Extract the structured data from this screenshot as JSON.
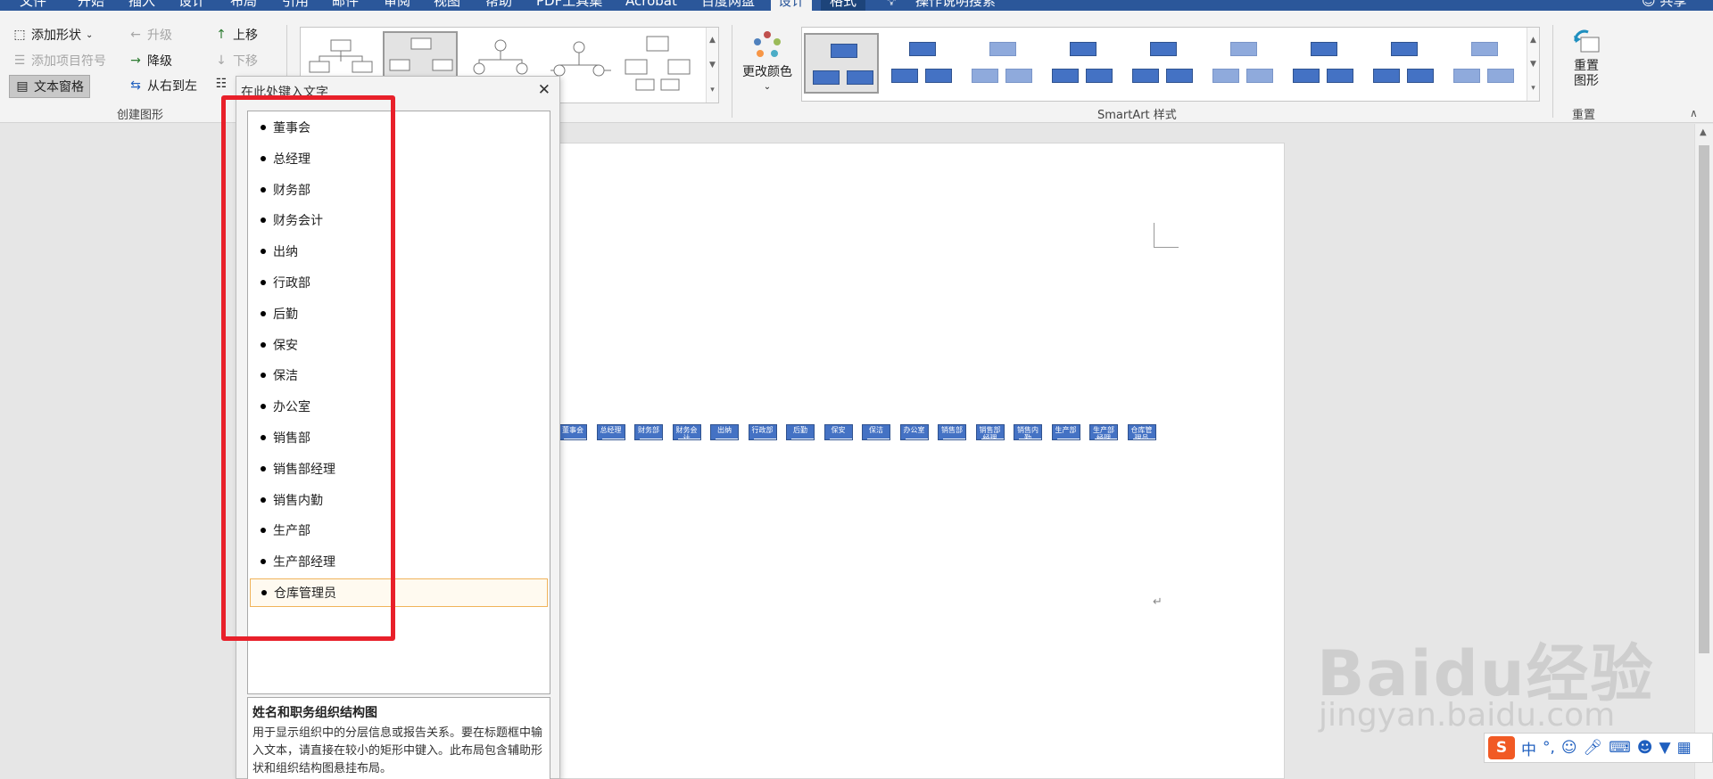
{
  "tabs": [
    "文件",
    "开始",
    "插入",
    "设计",
    "布局",
    "引用",
    "邮件",
    "审阅",
    "视图",
    "帮助",
    "PDF工具集",
    "Acrobat",
    "百度网盘",
    "设计",
    "格式",
    "操作说明搜索"
  ],
  "share_label": "共享",
  "ribbon": {
    "create_shape": {
      "add_shape": "添加形状",
      "add_bullet": "添加项目符号",
      "text_pane": "文本窗格",
      "promote": "升级",
      "demote": "降级",
      "right_to_left": "从右到左",
      "move_up": "上移",
      "move_down": "下移",
      "group_label": "创建图形"
    },
    "change_colors": "更改颜色",
    "smartart_styles_label": "SmartArt 样式",
    "reset_graphic": "重置图形",
    "reset_label": "重置"
  },
  "text_pane": {
    "title": "在此处键入文字",
    "items": [
      "董事会",
      "总经理",
      "财务部",
      "财务会计",
      "出纳",
      "行政部",
      "后勤",
      "保安",
      "保洁",
      "办公室",
      "销售部",
      "销售部经理",
      "销售内勤",
      "生产部",
      "生产部经理",
      "仓库管理员"
    ],
    "desc_title": "姓名和职务组织结构图",
    "desc_body": "用于显示组织中的分层信息或报告关系。要在标题框中输入文本，请直接在较小的矩形中键入。此布局包含辅助形状和组织结构图悬挂布局。"
  },
  "diagram_boxes": [
    "董事会",
    "总经理",
    "财务部",
    "财务会计",
    "出纳",
    "行政部",
    "后勤",
    "保安",
    "保洁",
    "办公室",
    "销售部",
    "销售部经理",
    "销售内勤",
    "生产部",
    "生产部经理",
    "仓库管理员"
  ],
  "watermark": {
    "brand": "Baidu经验",
    "url": "jingyan.baidu.com"
  },
  "ime": {
    "mode": "中",
    "punct": "°,"
  },
  "colors": {
    "title_bar": "#2b579a",
    "smartart_blue": "#4472c4",
    "highlight_red": "#e8202a"
  }
}
